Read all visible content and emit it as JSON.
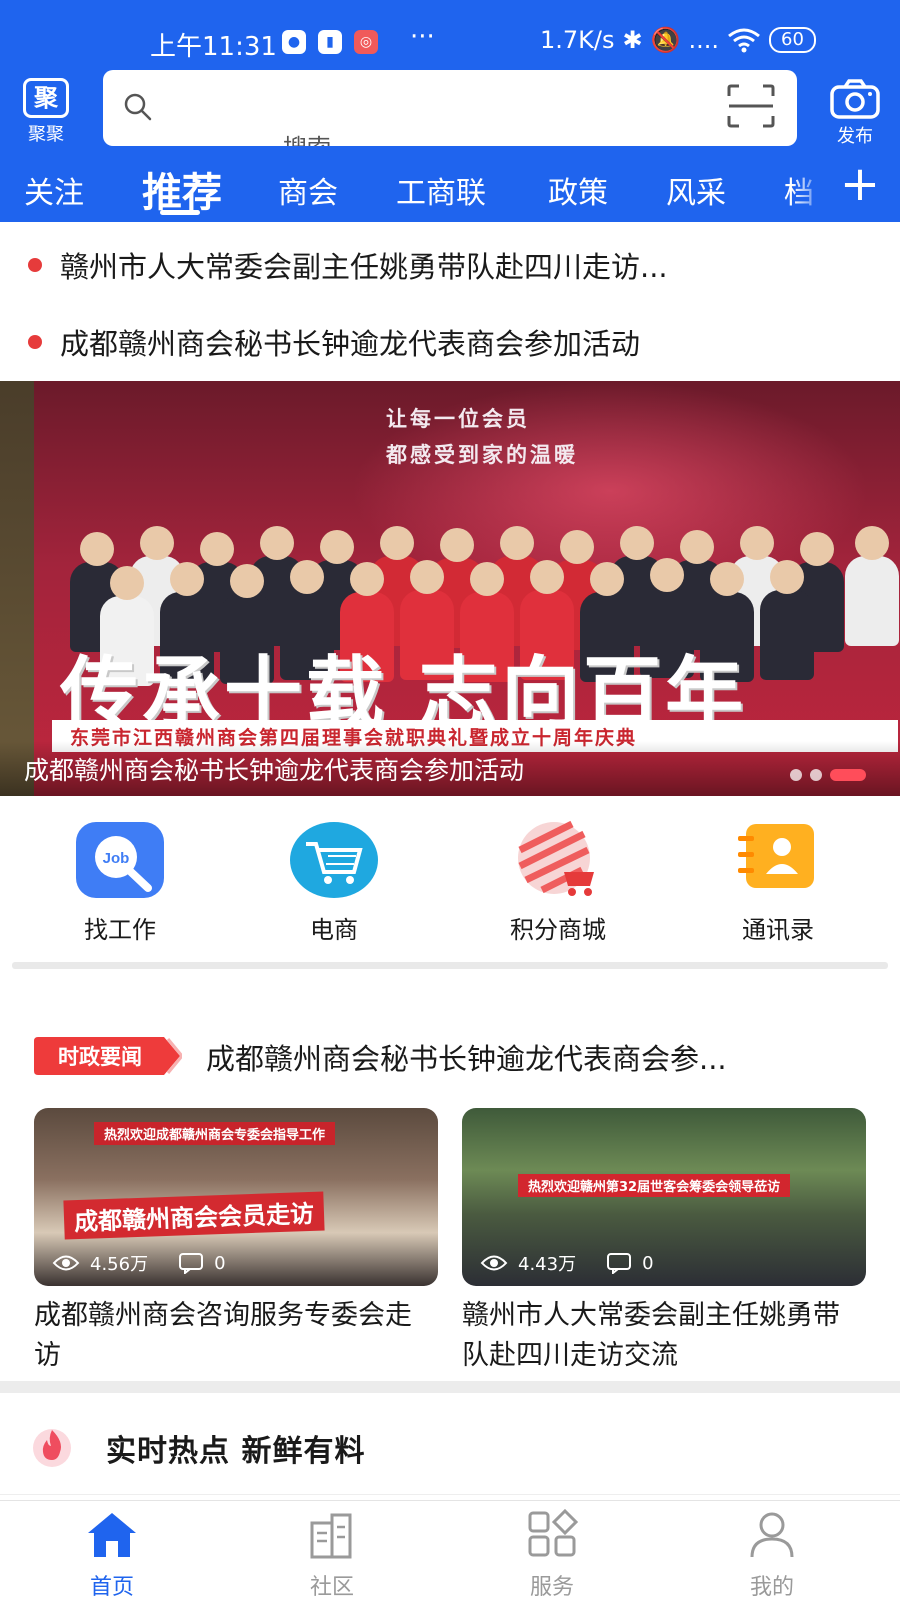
{
  "status_bar": {
    "time": "上午11:31",
    "more": "···",
    "network_speed": "1.7K/s",
    "signal_dots": "....",
    "battery": "60"
  },
  "header": {
    "logo_glyph": "聚",
    "logo_label": "聚聚",
    "search_placeholder": "搜索",
    "publish_label": "发布"
  },
  "tabs": [
    {
      "label": "关注"
    },
    {
      "label": "推荐",
      "active": true
    },
    {
      "label": "商会"
    },
    {
      "label": "工商联"
    },
    {
      "label": "政策"
    },
    {
      "label": "风采"
    },
    {
      "label": "档"
    }
  ],
  "headlines": [
    {
      "text": "赣州市人大常委会副主任姚勇带队赴四川走访..."
    },
    {
      "text": "成都赣州商会秘书长钟逾龙代表商会参加活动"
    }
  ],
  "banner": {
    "slogan_line1": "让每一位会员",
    "slogan_line2": "都感受到家的温暖",
    "big_title": "传承十载 志向百年",
    "event_line": "东莞市江西赣州商会第四届理事会就职典礼暨成立十周年庆典",
    "caption": "成都赣州商会秘书长钟逾龙代表商会参加活动",
    "slide_count": 3,
    "active_slide_index": 2
  },
  "shortcuts": [
    {
      "label": "找工作",
      "icon": "job-search-icon",
      "icon_text": "Job"
    },
    {
      "label": "电商",
      "icon": "shopping-cart-icon"
    },
    {
      "label": "积分商城",
      "icon": "points-mall-icon"
    },
    {
      "label": "通讯录",
      "icon": "contacts-icon"
    }
  ],
  "news": {
    "badge": "时政要闻",
    "headline": "成都赣州商会秘书长钟逾龙代表商会参...",
    "cards": [
      {
        "title": "成都赣州商会咨询服务专委会走访",
        "views": "4.56万",
        "comments": "0",
        "image_banner_top": "热烈欢迎成都赣州商会专委会指导工作",
        "image_banner_main": "成都赣州商会会员走访"
      },
      {
        "title": "赣州市人大常委会副主任姚勇带队赴四川走访交流",
        "views": "4.43万",
        "comments": "0",
        "image_banner_top": "热烈欢迎赣州第32届世客会筹委会领导莅访"
      }
    ]
  },
  "hot": {
    "text": "实时热点  新鲜有料"
  },
  "bottom_nav": [
    {
      "label": "首页",
      "icon": "home-icon",
      "active": true
    },
    {
      "label": "社区",
      "icon": "community-icon"
    },
    {
      "label": "服务",
      "icon": "services-icon"
    },
    {
      "label": "我的",
      "icon": "profile-icon"
    }
  ],
  "colors": {
    "primary": "#1f64ee",
    "accent_red": "#e63b3b",
    "nav_inactive": "#9a9a9a"
  }
}
